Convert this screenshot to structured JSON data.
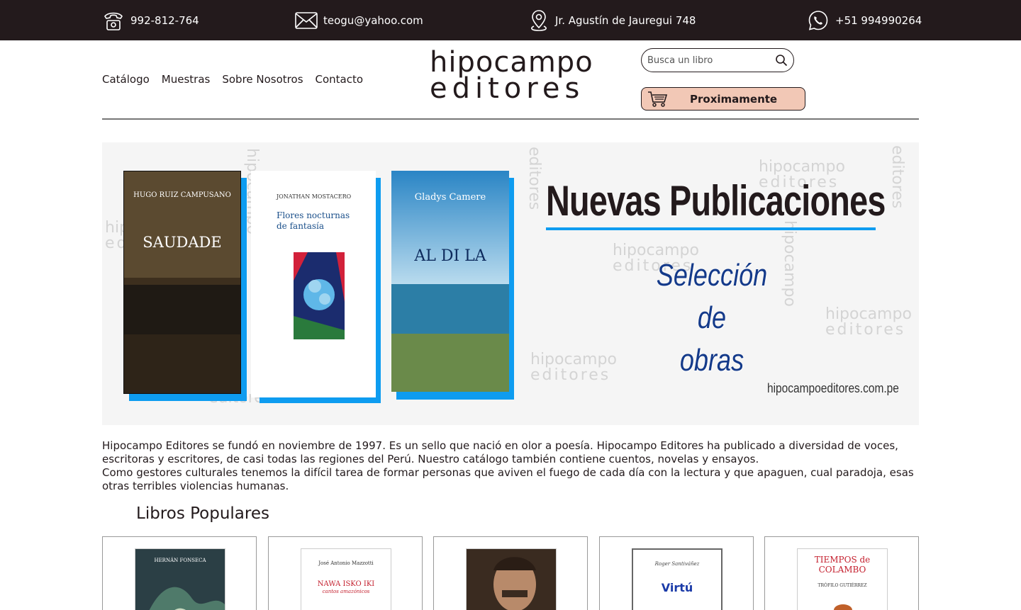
{
  "topbar": {
    "phone": "992-812-764",
    "email": "teogu@yahoo.com",
    "address": "Jr. Agustín de Jauregui 748",
    "whatsapp": "+51 994990264"
  },
  "nav": {
    "items": [
      "Catálogo",
      "Muestras",
      "Sobre Nosotros",
      "Contacto"
    ]
  },
  "logo": {
    "line1": "hipocampo",
    "line2": "editores"
  },
  "search": {
    "placeholder": "Busca un libro"
  },
  "cart": {
    "label": "Proximamente"
  },
  "banner": {
    "headline": "Nuevas Publicaciones",
    "subtitle_line1": "Selección de",
    "subtitle_line2": "obras",
    "url": "hipocampoeditores.com.pe",
    "watermark": [
      "hipocampo",
      "editores"
    ],
    "books": [
      {
        "author": "HUGO RUIZ CAMPUSANO",
        "title": "SAUDADE"
      },
      {
        "author": "JONATHAN MOSTACERO",
        "title": "Flores nocturnas de fantasía"
      },
      {
        "author": "Gladys Camere",
        "title": "AL DI LA"
      }
    ]
  },
  "about": {
    "p1": "Hipocampo Editores se fundó en noviembre de 1997. Es un sello que nació en olor a poesía. Hipocampo Editores ha publicado a diversidad de voces, escritoras y escritores, de casi todas las regiones del Perú. Nuestro catálogo también contiene cuentos, novelas y ensayos.",
    "p2": "Como gestores culturales tenemos la difícil tarea de formar personas que aviven el fuego de cada día con la lectura y que apaguen, cual paradoja, esas otras terribles violencias humanas."
  },
  "popular": {
    "title": "Libros Populares",
    "books": [
      {
        "author": "HERNÁN FONSECA",
        "title": ""
      },
      {
        "author": "José Antonio Mazzotti",
        "title": "NAWA ISKO IKI",
        "subtitle": "cantos amazónicos"
      },
      {
        "author": "",
        "title": ""
      },
      {
        "author": "Roger Santiváñez",
        "title": "Virtú"
      },
      {
        "author": "TRÓFILO GUTIÉRREZ",
        "title": "TIEMPOS de COLAMBO"
      }
    ]
  },
  "colors": {
    "dark": "#231a1c",
    "accent_blue": "#0e9cf0",
    "cart_bg": "#f2c8b6"
  }
}
